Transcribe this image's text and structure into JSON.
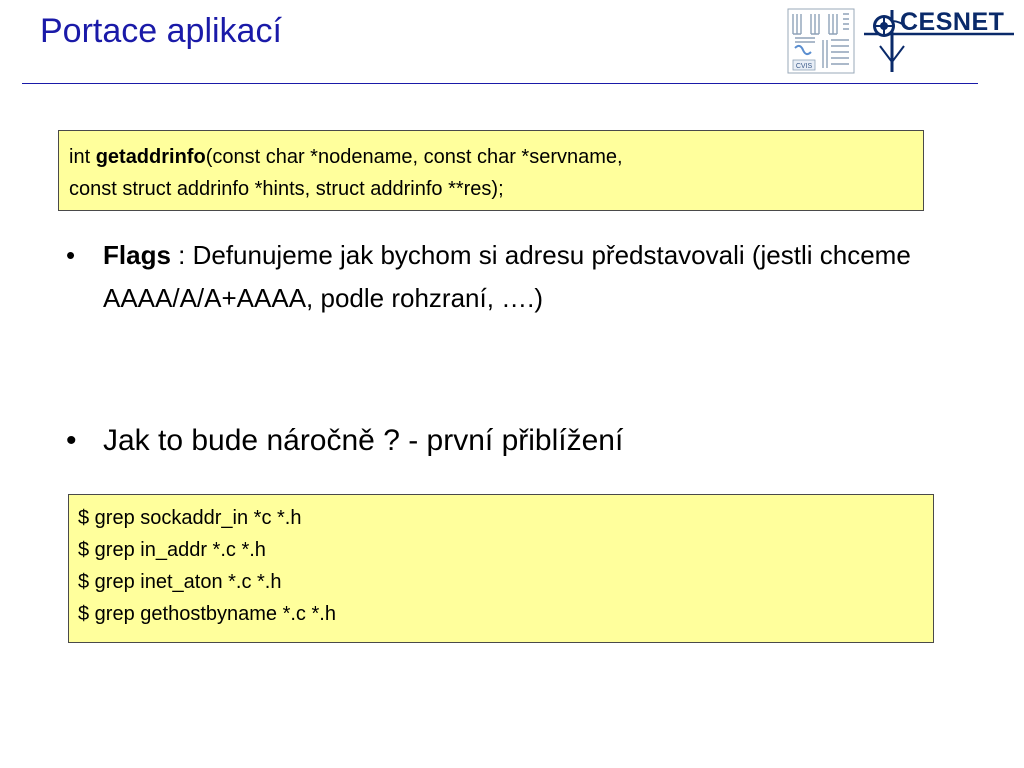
{
  "slide": {
    "title": "Portace aplikací"
  },
  "logos": {
    "cvis_label": "CVIS",
    "cesnet_label": "CESNET"
  },
  "signature_box": {
    "prefix": "int ",
    "function_name": "getaddrinfo",
    "params_line1": "(const char *nodename, const char *servname,",
    "params_line2": "const struct addrinfo *hints, struct addrinfo **res);"
  },
  "bullets": [
    {
      "marker": "•",
      "bold_label": "Flags",
      "text": " : Defunujeme jak bychom si adresu představovali (jestli chceme AAAA/A/A+AAAA, podle rohzraní, ….)"
    },
    {
      "marker": "•",
      "text": "Jak to bude náročně ?  - první přiblížení"
    }
  ],
  "commands_box": {
    "lines": [
      "$ grep sockaddr_in *c *.h",
      "$ grep in_addr *.c *.h",
      "$ grep inet_aton *.c *.h",
      "$ grep gethostbyname *.c *.h"
    ]
  },
  "colors": {
    "title": "#1a1aa8",
    "box_fill": "#ffff9c",
    "box_border": "#4a4a4a"
  }
}
